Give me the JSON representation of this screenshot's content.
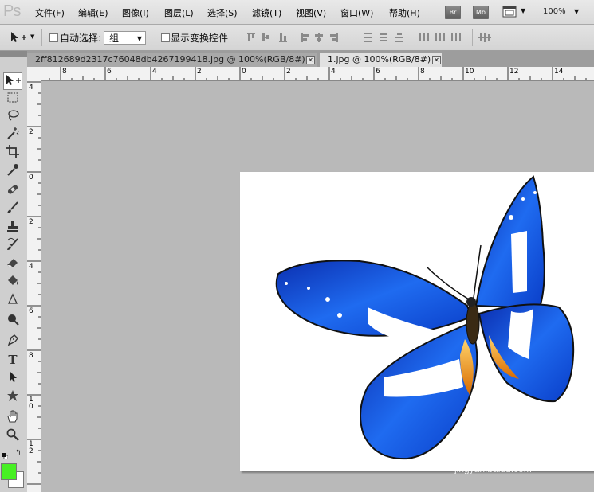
{
  "app": {
    "logo": "Ps"
  },
  "menubar": {
    "items": [
      "文件(F)",
      "编辑(E)",
      "图像(I)",
      "图层(L)",
      "选择(S)",
      "滤镜(T)",
      "视图(V)",
      "窗口(W)",
      "帮助(H)"
    ],
    "bridge_label": "Br",
    "minibridge_label": "Mb",
    "zoom": "100%"
  },
  "options": {
    "auto_select_label": "自动选择:",
    "auto_select_value": "组",
    "show_transform_label": "显示变换控件"
  },
  "tabs": [
    {
      "label": "2ff812689d2317c76048db4267199418.jpg @ 100%(RGB/8#)",
      "active": false
    },
    {
      "label": "1.jpg @ 100%(RGB/8#)",
      "active": true
    }
  ],
  "ruler": {
    "h_ticks": [
      "8",
      "6",
      "4",
      "2",
      "0",
      "2",
      "4",
      "6",
      "8",
      "10",
      "12",
      "14"
    ],
    "v_ticks": [
      "4",
      "2",
      "0",
      "2",
      "4",
      "6",
      "8",
      "1\n0",
      "1\n2"
    ]
  },
  "colors": {
    "foreground": "#47f023",
    "background": "#ffffff"
  },
  "watermark": {
    "brand": "Baidu经验",
    "url": "jingyan.baidu.com"
  },
  "tools": [
    "move-tool",
    "marquee-tool",
    "lasso-tool",
    "magic-wand-tool",
    "crop-tool",
    "eyedropper-tool",
    "healing-brush-tool",
    "brush-tool",
    "clone-stamp-tool",
    "history-brush-tool",
    "eraser-tool",
    "paint-bucket-tool",
    "blur-tool",
    "dodge-tool",
    "pen-tool",
    "type-tool",
    "path-selection-tool",
    "shape-tool",
    "hand-tool",
    "zoom-tool"
  ]
}
